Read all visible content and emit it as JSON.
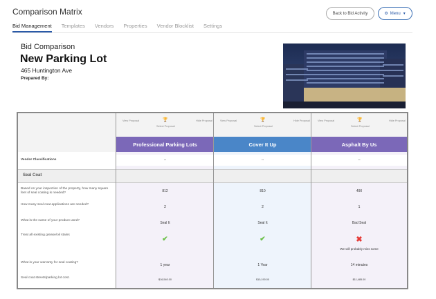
{
  "app": {
    "title": "Comparison Matrix"
  },
  "buttons": {
    "back_to_bid_activity": "Back to Bid Activity",
    "menu": "Menu"
  },
  "tabs": [
    "Bid Management",
    "Templates",
    "Vendors",
    "Properties",
    "Vendor Blocklist",
    "Settings"
  ],
  "active_tab": "Bid Management",
  "bid": {
    "label": "Bid Comparison",
    "project_name": "New Parking Lot",
    "address": "465 Huntington Ave",
    "prepared_by_label": "Prepared By:"
  },
  "vendor_header": {
    "view_proposal": "View Proposal",
    "hide_proposal": "Hide Proposal",
    "select_proposal": "Select Proposal"
  },
  "vendors": [
    {
      "name": "Professional Parking Lots",
      "color": "#7b68b8",
      "classification": "--"
    },
    {
      "name": "Cover It Up",
      "color": "#4a86c8",
      "classification": "--"
    },
    {
      "name": "Asphalt By Us",
      "color": "#7b68b8",
      "classification": "--"
    }
  ],
  "rows": {
    "vendor_classifications": "Vendor Classifications",
    "section": "Seal Coat",
    "questions": [
      {
        "q": "Based on your inspection of the property, how many square feet of seal coating is needed?",
        "answers": [
          "812",
          "810",
          "490"
        ]
      },
      {
        "q": "How many seal coat applications are needed?",
        "answers": [
          "2",
          "2",
          "1"
        ]
      },
      {
        "q": "What is the name of your product used?",
        "answers": [
          "Seal It",
          "Seal It",
          "Bad Seal"
        ]
      },
      {
        "q": "Treat all existing grease/oil stains",
        "answers": [
          "check",
          "check",
          "x"
        ],
        "note": [
          "",
          "",
          "We will probably miss some"
        ]
      },
      {
        "q": "What is your warranty for seal coating?",
        "answers": [
          "1 year",
          "1 Year",
          "14 minutes"
        ]
      },
      {
        "q": "Seal coat streets/parking lot cost.",
        "answers": [
          "$16,540.00",
          "$10,190.00",
          "$11,485.00"
        ]
      }
    ]
  },
  "icons": {
    "gear": "gear-icon",
    "caret": "chevron-down-icon",
    "trophy": "trophy-icon",
    "check": "check-icon",
    "x": "x-icon"
  },
  "colors": {
    "accent": "#2a5aa8",
    "vendor_purple": "#7b68b8",
    "vendor_blue": "#4a86c8",
    "check_green": "#6cc04a",
    "x_red": "#e53935",
    "col_purple_bg": "#f4f1f9",
    "col_blue_bg": "#eef4fc"
  }
}
